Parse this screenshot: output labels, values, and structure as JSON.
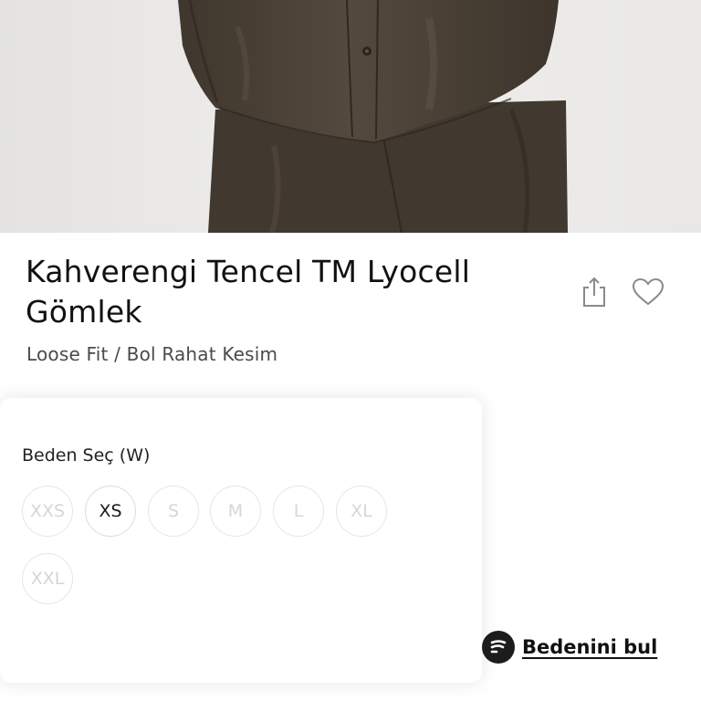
{
  "product": {
    "title": "Kahverengi Tencel TM Lyocell Gömlek",
    "fit": "Loose Fit / Bol Rahat Kesim"
  },
  "actions": {
    "share_icon": "share-icon",
    "favorite_icon": "heart-icon"
  },
  "size_selector": {
    "label": "Beden Seç (W)",
    "sizes": [
      {
        "label": "XXS",
        "available": false
      },
      {
        "label": "XS",
        "available": true
      },
      {
        "label": "S",
        "available": false
      },
      {
        "label": "M",
        "available": false
      },
      {
        "label": "L",
        "available": false
      },
      {
        "label": "XL",
        "available": false
      },
      {
        "label": "XXL",
        "available": false
      }
    ]
  },
  "find_size": {
    "label": "Bedenini bul",
    "icon": "size-finder-icon"
  },
  "colors": {
    "garment": "#4a4136",
    "background_photo": "#ebeae8",
    "text_primary": "#111111",
    "size_unavailable": "#d6d6d6"
  }
}
